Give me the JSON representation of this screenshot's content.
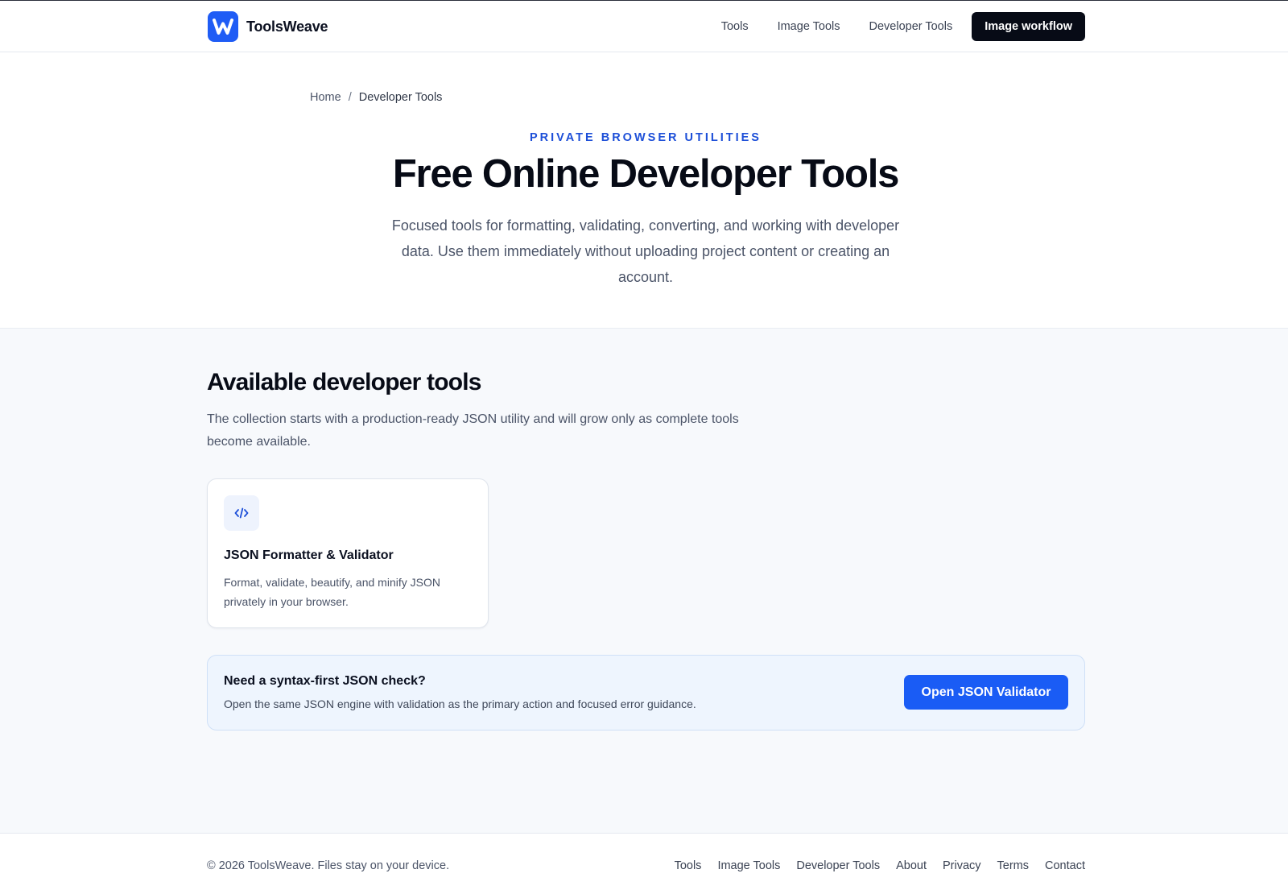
{
  "header": {
    "brand": {
      "name": "ToolsWeave",
      "logo_letter": "W",
      "logo_color": "#1f5cf5"
    },
    "nav": [
      {
        "label": "Tools"
      },
      {
        "label": "Image Tools"
      },
      {
        "label": "Developer Tools"
      }
    ],
    "cta_label": "Image workflow"
  },
  "breadcrumb": {
    "home": "Home",
    "separator": "/",
    "current": "Developer Tools"
  },
  "hero": {
    "eyebrow": "PRIVATE BROWSER UTILITIES",
    "title": "Free Online Developer Tools",
    "subtitle": "Focused tools for formatting, validating, converting, and working with developer data. Use them immediately without uploading project content or creating an account."
  },
  "main": {
    "section_title": "Available developer tools",
    "section_desc": "The collection starts with a production-ready JSON utility and will grow only as complete tools become available.",
    "tools": [
      {
        "icon": "code-icon",
        "title": "JSON Formatter & Validator",
        "description": "Format, validate, beautify, and minify JSON privately in your browser."
      }
    ],
    "callout": {
      "title": "Need a syntax-first JSON check?",
      "description": "Open the same JSON engine with validation as the primary action and focused error guidance.",
      "button_label": "Open JSON Validator"
    }
  },
  "footer": {
    "copyright": "© 2026 ToolsWeave. Files stay on your device.",
    "links": [
      {
        "label": "Tools"
      },
      {
        "label": "Image Tools"
      },
      {
        "label": "Developer Tools"
      },
      {
        "label": "About"
      },
      {
        "label": "Privacy"
      },
      {
        "label": "Terms"
      },
      {
        "label": "Contact"
      }
    ]
  },
  "colors": {
    "accent": "#1a5cf5",
    "eyebrow": "#1d4fd8",
    "dark_button": "#070b16",
    "section_bg": "#f7f9fc",
    "callout_bg": "#eef5fe"
  }
}
